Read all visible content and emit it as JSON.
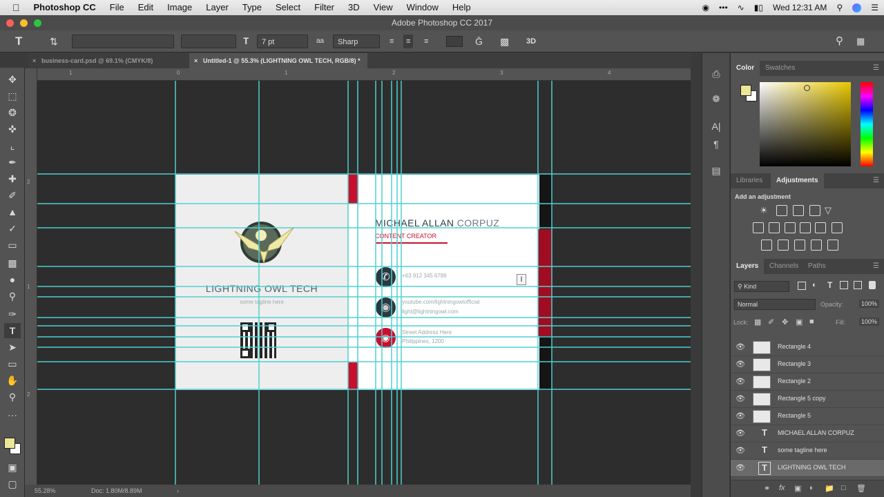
{
  "menubar": {
    "app": "Photoshop CC",
    "items": [
      "File",
      "Edit",
      "Image",
      "Layer",
      "Type",
      "Select",
      "Filter",
      "3D",
      "View",
      "Window",
      "Help"
    ],
    "datetime": "Wed 12:31 AM"
  },
  "window": {
    "title": "Adobe Photoshop CC 2017"
  },
  "options": {
    "tool_icon": "T",
    "font_family_value": "",
    "font_size_value": "7 pt",
    "antialias_value": "Sharp",
    "aa_label": "aa"
  },
  "tabs": [
    {
      "label": "business-card.psd @ 69.1% (CMYK/8)",
      "active": false
    },
    {
      "label": "Untitled-1 @ 55.3% (LIGHTNING OWL TECH, RGB/8) *",
      "active": true
    }
  ],
  "rulers": {
    "h_ticks": [
      "1",
      "0",
      "1",
      "2",
      "3",
      "4"
    ],
    "v_ticks": [
      "2",
      "1",
      "2"
    ]
  },
  "card": {
    "company": "LIGHTNING OWL TECH",
    "tagline": "some tagline here",
    "name_first": "MICHAEL ALLAN",
    "name_last": "CORPUZ",
    "title": "CONTENT CREATOR",
    "phone": "+63 912 345 6789",
    "web": "youtube.com/lightningowlofficial",
    "email": "light@lightningowl.com",
    "address1": "Street Address Here",
    "address2": "Philippines, 1200",
    "accent": "#c8102e",
    "icon_bg": "#283a40"
  },
  "status": {
    "zoom": "55.28%",
    "doc": "Doc: 1.80M/8.89M"
  },
  "color_panel": {
    "tabs": [
      "Color",
      "Swatches"
    ],
    "foreground": "#ece798",
    "background": "#ffffff",
    "field_hue": "#e8c800"
  },
  "adjustments_panel": {
    "tabs": [
      "Libraries",
      "Adjustments"
    ],
    "hint": "Add an adjustment"
  },
  "layers_panel": {
    "tabs": [
      "Layers",
      "Channels",
      "Paths"
    ],
    "filter_kind": "Kind",
    "blend_mode": "Normal",
    "opacity_label": "Opacity:",
    "opacity_value": "100%",
    "lock_label": "Lock:",
    "fill_label": "Fill:",
    "fill_value": "100%",
    "layers": [
      {
        "name": "Rectangle 4",
        "type": "shape"
      },
      {
        "name": "Rectangle 3",
        "type": "shape"
      },
      {
        "name": "Rectangle 2",
        "type": "shape"
      },
      {
        "name": "Rectangle 5 copy",
        "type": "shape"
      },
      {
        "name": "Rectangle 5",
        "type": "shape"
      },
      {
        "name": "MICHAEL ALLAN CORPUZ",
        "type": "text"
      },
      {
        "name": "some tagline here",
        "type": "text"
      },
      {
        "name": "LIGHTNING OWL TECH",
        "type": "text"
      }
    ]
  }
}
